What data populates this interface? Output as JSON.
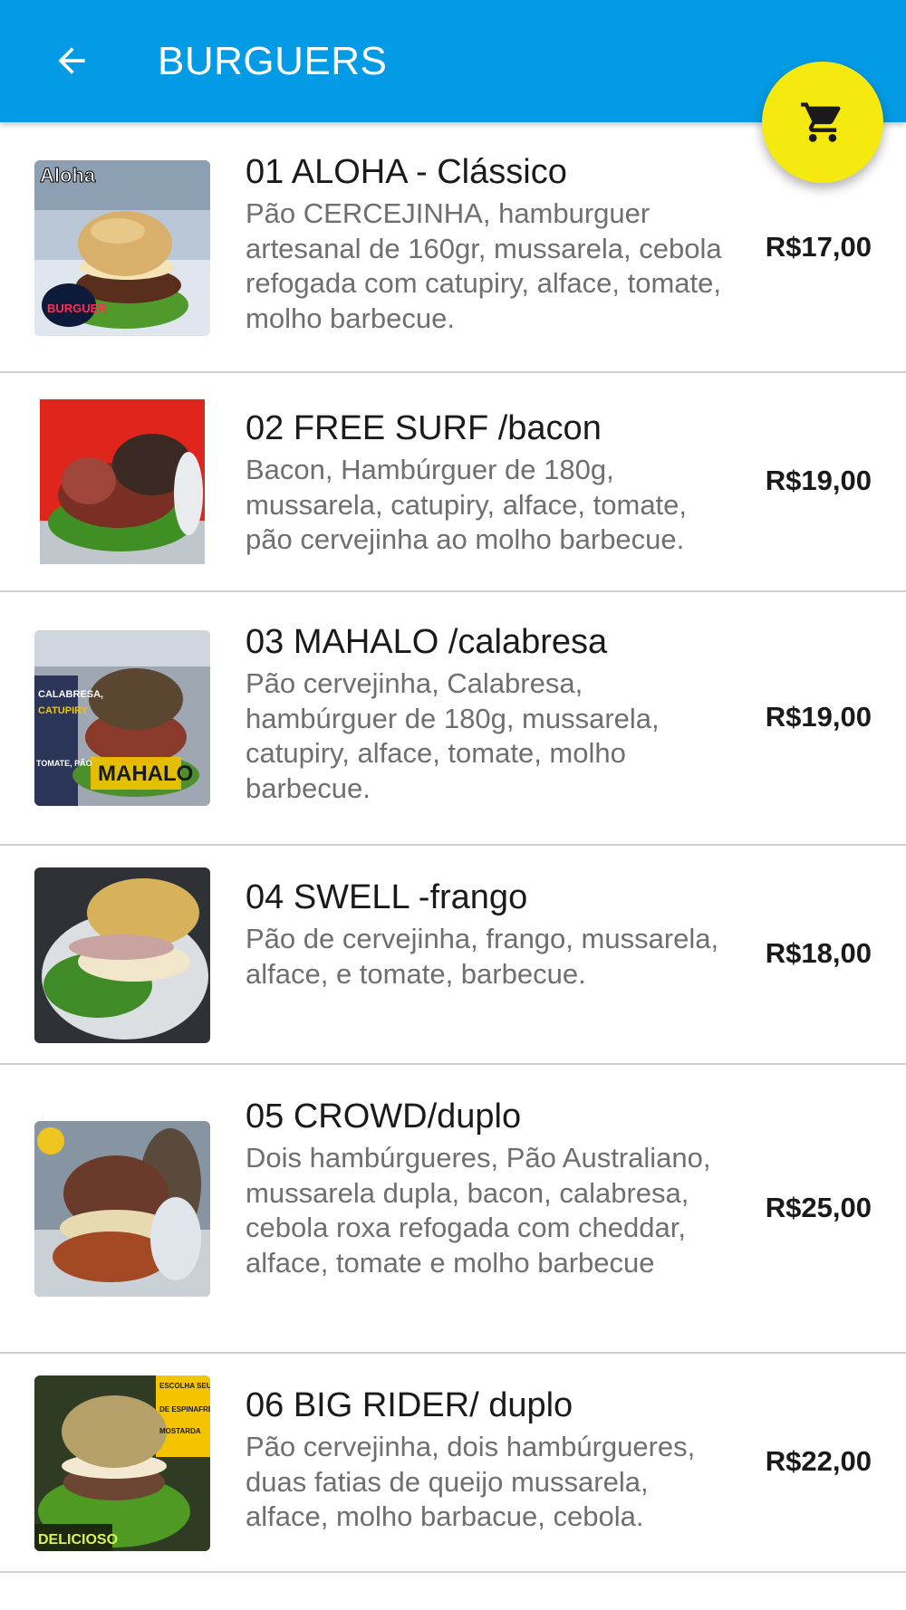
{
  "appbar": {
    "title": "BURGUERS",
    "back_icon": "arrow-back-icon",
    "cart_icon": "shopping-cart-icon",
    "color": "#039be5",
    "fab_color": "#f5e90f"
  },
  "items": [
    {
      "name": "01 ALOHA - Clássico",
      "description": "Pão CERCEJINHA, hamburguer artesanal de 160gr, mussarela, cebola refogada com catupiry, alface, tomate, molho barbecue.",
      "price": "R$17,00",
      "photo_label": "Aloha",
      "photo_logo": "BURGUER"
    },
    {
      "name": "02 FREE SURF /bacon",
      "description": "Bacon, Hambúrguer de 180g, mussarela, catupiry, alface, tomate, pão cervejinha ao molho barbecue.",
      "price": "R$19,00"
    },
    {
      "name": "03 MAHALO /calabresa",
      "description": "Pão cervejinha, Calabresa, hambúrguer de 180g, mussarela, catupiry, alface, tomate, molho barbecue.",
      "price": "R$19,00",
      "photo_label": "MAHALO",
      "photo_side": [
        "CALABRESA,",
        "CATUPIRY",
        "TOMATE, PÃO"
      ]
    },
    {
      "name": "04 SWELL -frango",
      "description": "Pão de cervejinha, frango, mussarela, alface, e tomate, barbecue.",
      "price": "R$18,00"
    },
    {
      "name": "05 CROWD/duplo",
      "description": "Dois hambúrgueres, Pão Australiano, mussarela dupla, bacon, calabresa, cebola roxa refogada com cheddar, alface, tomate e molho barbecue",
      "price": "R$25,00"
    },
    {
      "name": "06 BIG RIDER/ duplo",
      "description": "Pão cervejinha, dois hambúrgueres, duas fatias de queijo mussarela, alface, molho barbacue, cebola.",
      "price": "R$22,00",
      "photo_label": "DELICIOSO",
      "photo_side": [
        "ESCOLHA SEU",
        "DE ESPINAFRE",
        "MOSTARDA"
      ]
    }
  ]
}
